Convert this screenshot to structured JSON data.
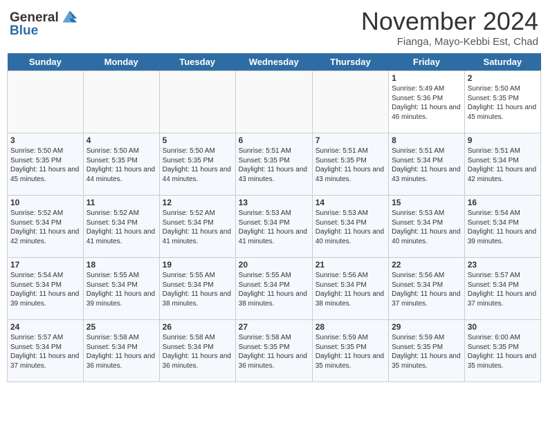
{
  "header": {
    "logo_line1": "General",
    "logo_line2": "Blue",
    "month": "November 2024",
    "location": "Fianga, Mayo-Kebbi Est, Chad"
  },
  "weekdays": [
    "Sunday",
    "Monday",
    "Tuesday",
    "Wednesday",
    "Thursday",
    "Friday",
    "Saturday"
  ],
  "weeks": [
    [
      {
        "day": "",
        "info": ""
      },
      {
        "day": "",
        "info": ""
      },
      {
        "day": "",
        "info": ""
      },
      {
        "day": "",
        "info": ""
      },
      {
        "day": "",
        "info": ""
      },
      {
        "day": "1",
        "info": "Sunrise: 5:49 AM\nSunset: 5:36 PM\nDaylight: 11 hours and 46 minutes."
      },
      {
        "day": "2",
        "info": "Sunrise: 5:50 AM\nSunset: 5:35 PM\nDaylight: 11 hours and 45 minutes."
      }
    ],
    [
      {
        "day": "3",
        "info": "Sunrise: 5:50 AM\nSunset: 5:35 PM\nDaylight: 11 hours and 45 minutes."
      },
      {
        "day": "4",
        "info": "Sunrise: 5:50 AM\nSunset: 5:35 PM\nDaylight: 11 hours and 44 minutes."
      },
      {
        "day": "5",
        "info": "Sunrise: 5:50 AM\nSunset: 5:35 PM\nDaylight: 11 hours and 44 minutes."
      },
      {
        "day": "6",
        "info": "Sunrise: 5:51 AM\nSunset: 5:35 PM\nDaylight: 11 hours and 43 minutes."
      },
      {
        "day": "7",
        "info": "Sunrise: 5:51 AM\nSunset: 5:35 PM\nDaylight: 11 hours and 43 minutes."
      },
      {
        "day": "8",
        "info": "Sunrise: 5:51 AM\nSunset: 5:34 PM\nDaylight: 11 hours and 43 minutes."
      },
      {
        "day": "9",
        "info": "Sunrise: 5:51 AM\nSunset: 5:34 PM\nDaylight: 11 hours and 42 minutes."
      }
    ],
    [
      {
        "day": "10",
        "info": "Sunrise: 5:52 AM\nSunset: 5:34 PM\nDaylight: 11 hours and 42 minutes."
      },
      {
        "day": "11",
        "info": "Sunrise: 5:52 AM\nSunset: 5:34 PM\nDaylight: 11 hours and 41 minutes."
      },
      {
        "day": "12",
        "info": "Sunrise: 5:52 AM\nSunset: 5:34 PM\nDaylight: 11 hours and 41 minutes."
      },
      {
        "day": "13",
        "info": "Sunrise: 5:53 AM\nSunset: 5:34 PM\nDaylight: 11 hours and 41 minutes."
      },
      {
        "day": "14",
        "info": "Sunrise: 5:53 AM\nSunset: 5:34 PM\nDaylight: 11 hours and 40 minutes."
      },
      {
        "day": "15",
        "info": "Sunrise: 5:53 AM\nSunset: 5:34 PM\nDaylight: 11 hours and 40 minutes."
      },
      {
        "day": "16",
        "info": "Sunrise: 5:54 AM\nSunset: 5:34 PM\nDaylight: 11 hours and 39 minutes."
      }
    ],
    [
      {
        "day": "17",
        "info": "Sunrise: 5:54 AM\nSunset: 5:34 PM\nDaylight: 11 hours and 39 minutes."
      },
      {
        "day": "18",
        "info": "Sunrise: 5:55 AM\nSunset: 5:34 PM\nDaylight: 11 hours and 39 minutes."
      },
      {
        "day": "19",
        "info": "Sunrise: 5:55 AM\nSunset: 5:34 PM\nDaylight: 11 hours and 38 minutes."
      },
      {
        "day": "20",
        "info": "Sunrise: 5:55 AM\nSunset: 5:34 PM\nDaylight: 11 hours and 38 minutes."
      },
      {
        "day": "21",
        "info": "Sunrise: 5:56 AM\nSunset: 5:34 PM\nDaylight: 11 hours and 38 minutes."
      },
      {
        "day": "22",
        "info": "Sunrise: 5:56 AM\nSunset: 5:34 PM\nDaylight: 11 hours and 37 minutes."
      },
      {
        "day": "23",
        "info": "Sunrise: 5:57 AM\nSunset: 5:34 PM\nDaylight: 11 hours and 37 minutes."
      }
    ],
    [
      {
        "day": "24",
        "info": "Sunrise: 5:57 AM\nSunset: 5:34 PM\nDaylight: 11 hours and 37 minutes."
      },
      {
        "day": "25",
        "info": "Sunrise: 5:58 AM\nSunset: 5:34 PM\nDaylight: 11 hours and 36 minutes."
      },
      {
        "day": "26",
        "info": "Sunrise: 5:58 AM\nSunset: 5:34 PM\nDaylight: 11 hours and 36 minutes."
      },
      {
        "day": "27",
        "info": "Sunrise: 5:58 AM\nSunset: 5:35 PM\nDaylight: 11 hours and 36 minutes."
      },
      {
        "day": "28",
        "info": "Sunrise: 5:59 AM\nSunset: 5:35 PM\nDaylight: 11 hours and 35 minutes."
      },
      {
        "day": "29",
        "info": "Sunrise: 5:59 AM\nSunset: 5:35 PM\nDaylight: 11 hours and 35 minutes."
      },
      {
        "day": "30",
        "info": "Sunrise: 6:00 AM\nSunset: 5:35 PM\nDaylight: 11 hours and 35 minutes."
      }
    ]
  ]
}
